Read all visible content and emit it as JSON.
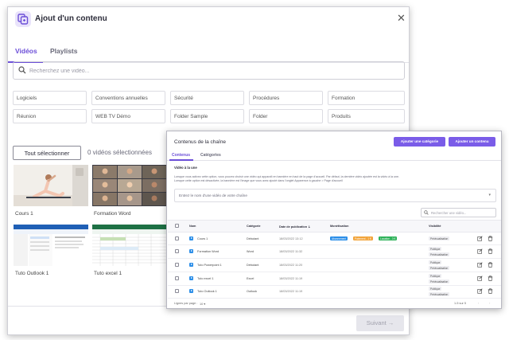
{
  "modal": {
    "title": "Ajout d'un contenu",
    "tabs": [
      "Vidéos",
      "Playlists"
    ],
    "search_placeholder": "Recherchez une vidéo...",
    "categories": [
      "Logiciels",
      "Conventions annuelles",
      "Sécurité",
      "Procédures",
      "Formation",
      "Réunion",
      "WEB TV Démo",
      "Folder Sample",
      "Folder",
      "Produits"
    ],
    "select_all": "Tout sélectionner",
    "selected_count": "0 vidéos sélectionnées",
    "videos": [
      {
        "label": "Cours 1",
        "thumb": "yoga-thumbnail-icon"
      },
      {
        "label": "Formation Word",
        "thumb": "video-call-thumbnail-icon"
      },
      {
        "label": "Tuto Outlook 1",
        "thumb": "outlook-screenshot-thumbnail-icon"
      },
      {
        "label": "Tuto excel 1",
        "thumb": "excel-screenshot-thumbnail-icon"
      }
    ],
    "next_button": "Suivant"
  },
  "panel": {
    "title": "Contenus de la chaîne",
    "add_category_button": "Ajouter une catégorie",
    "add_content_button": "Ajouter un contenu",
    "tabs": [
      "Contenus",
      "Catégories"
    ],
    "featured_heading": "Vidéo à la une",
    "featured_desc_1": "Lorsque vous activez cette option, vous pouvez choisir une vidéo qui apparaît en bannière en haut de la page d'accueil. Par défaut, la dernière vidéo ajoutée est la vidéo à la une.",
    "featured_desc_2": "Lorsque cette option est désactivée, la bannière est l'image que vous avez ajouté dans l'onglet Apparence à gauche > Page d'accueil",
    "video_combo_placeholder": "Entrez le nom d'une vidéo de votre chaîne",
    "search_placeholder": "Rechercher une vidéo...",
    "columns": [
      "Nom",
      "Catégorie",
      "Date de publication",
      "Monétisation",
      "Visibilité"
    ],
    "rows": [
      {
        "name": "Cours 1",
        "category": "Débutant",
        "date": "18/03/2022 13:12",
        "monetization": [
          "Abonnement",
          "Paiement - 1 €",
          "Location - 3 €"
        ],
        "visibility": [
          "Prévisualisation"
        ]
      },
      {
        "name": "Formation Word",
        "category": "Word",
        "date": "18/03/2022 11:32",
        "monetization": [],
        "visibility": [
          "Publique",
          "Prévisualisation"
        ]
      },
      {
        "name": "Tuto Powerpoint 1",
        "category": "Débutant",
        "date": "18/03/2022 11:20",
        "monetization": [],
        "visibility": [
          "Publique",
          "Prévisualisation"
        ]
      },
      {
        "name": "Tuto excel 1",
        "category": "Excel",
        "date": "18/03/2022 11:19",
        "monetization": [],
        "visibility": [
          "Publique",
          "Prévisualisation"
        ]
      },
      {
        "name": "Tuto Outlook 1",
        "category": "Outlook",
        "date": "18/03/2022 11:19",
        "monetization": [],
        "visibility": [
          "Publique",
          "Prévisualisation"
        ]
      }
    ],
    "rows_per_page_label": "Lignes par page :",
    "rows_per_page_value": "10",
    "pagination": "1-5 sur 5"
  },
  "colors": {
    "accent": "#6c4fd8",
    "button": "#7a5ce8",
    "chip_blue": "#2b8ee8",
    "chip_orange": "#f2a43a",
    "chip_green": "#2fb25a"
  }
}
